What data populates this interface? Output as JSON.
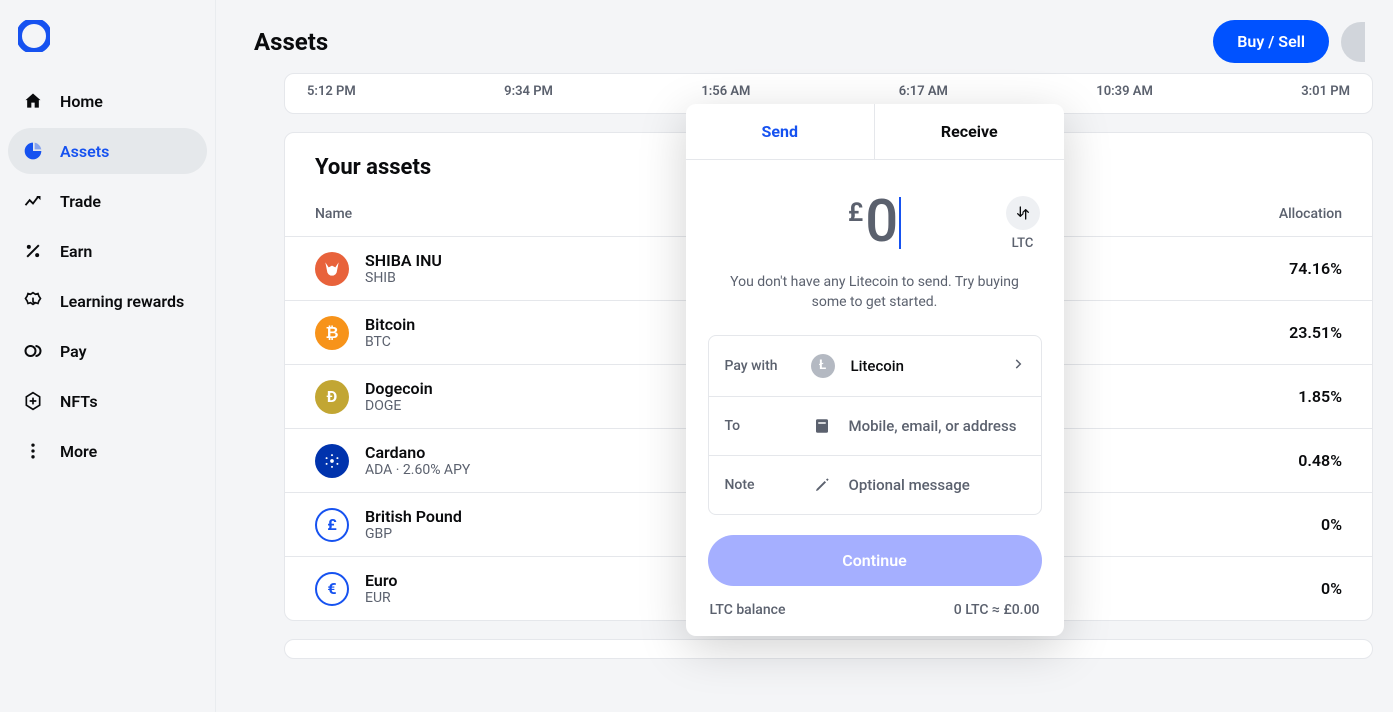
{
  "page": {
    "title": "Assets"
  },
  "actions": {
    "buy_sell": "Buy / Sell"
  },
  "sidebar": {
    "items": [
      {
        "label": "Home"
      },
      {
        "label": "Assets"
      },
      {
        "label": "Trade"
      },
      {
        "label": "Earn"
      },
      {
        "label": "Learning rewards"
      },
      {
        "label": "Pay"
      },
      {
        "label": "NFTs"
      },
      {
        "label": "More"
      }
    ]
  },
  "timeline": {
    "ticks": [
      "5:12 PM",
      "9:34 PM",
      "1:56 AM",
      "6:17 AM",
      "10:39 AM",
      "3:01 PM"
    ]
  },
  "assets": {
    "heading": "Your assets",
    "col_name": "Name",
    "col_alloc": "Allocation",
    "rows": [
      {
        "name": "SHIBA INU",
        "sub": "SHIB",
        "alloc": "74.16%",
        "icon": "shib"
      },
      {
        "name": "Bitcoin",
        "sub": "BTC",
        "alloc": "23.51%",
        "icon": "btc"
      },
      {
        "name": "Dogecoin",
        "sub": "DOGE",
        "alloc": "1.85%",
        "icon": "doge"
      },
      {
        "name": "Cardano",
        "sub": "ADA · 2.60% APY",
        "alloc": "0.48%",
        "icon": "ada"
      },
      {
        "name": "British Pound",
        "sub": "GBP",
        "alloc": "0%",
        "icon": "gbp"
      },
      {
        "name": "Euro",
        "sub": "EUR",
        "alloc": "0%",
        "icon": "eur"
      }
    ]
  },
  "modal": {
    "tab_send": "Send",
    "tab_receive": "Receive",
    "currency_symbol": "£",
    "amount": "0",
    "swap_label": "LTC",
    "message": "You don't have any Litecoin to send. Try buying some to get started.",
    "paywith_label": "Pay with",
    "paywith_value": "Litecoin",
    "to_label": "To",
    "to_placeholder": "Mobile, email, or address",
    "note_label": "Note",
    "note_placeholder": "Optional message",
    "continue": "Continue",
    "balance_label": "LTC balance",
    "balance_value": "0 LTC ≈ £0.00"
  }
}
